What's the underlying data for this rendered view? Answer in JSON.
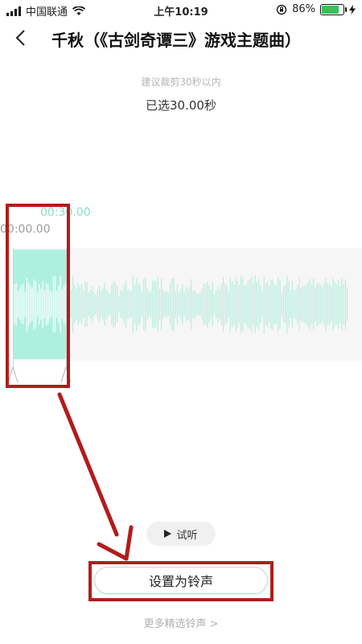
{
  "status_bar": {
    "carrier": "中国联通",
    "time": "上午10:19",
    "battery_pct": "86%",
    "battery_level": 0.86
  },
  "nav": {
    "title": "千秋（《古剑奇谭三》游戏主题曲）"
  },
  "editor": {
    "hint": "建议裁剪30秒以内",
    "selected": "已选30.00秒",
    "time_start": "00:00.00",
    "time_end": "00:30.00"
  },
  "actions": {
    "preview": "试听",
    "set_ringtone": "设置为铃声",
    "more_ringtones": "更多精选铃声 >"
  },
  "colors": {
    "selection": "#aef0e0",
    "wave_selected": "#ffffff",
    "wave_unselected": "#b9eedf",
    "annotation": "#b21c1c"
  }
}
